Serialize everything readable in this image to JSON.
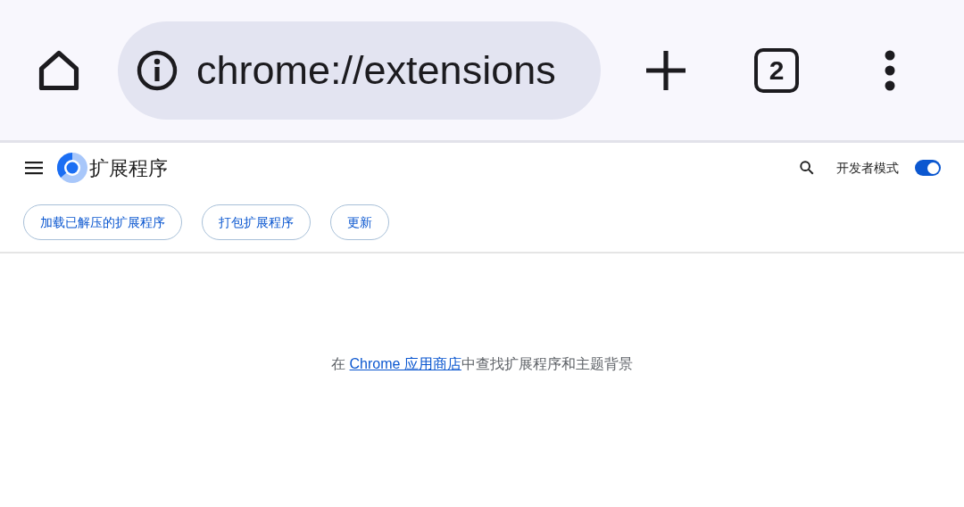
{
  "browser_bar": {
    "url": "chrome://extensions",
    "tab_count": "2"
  },
  "header": {
    "title": "扩展程序",
    "developer_mode": {
      "label": "开发者模式",
      "on": true
    }
  },
  "toolbar_buttons": [
    "加载已解压的扩展程序",
    "打包扩展程序",
    "更新"
  ],
  "empty_message": {
    "before": "在 ",
    "link": "Chrome 应用商店",
    "after": "中查找扩展程序和主题背景"
  }
}
